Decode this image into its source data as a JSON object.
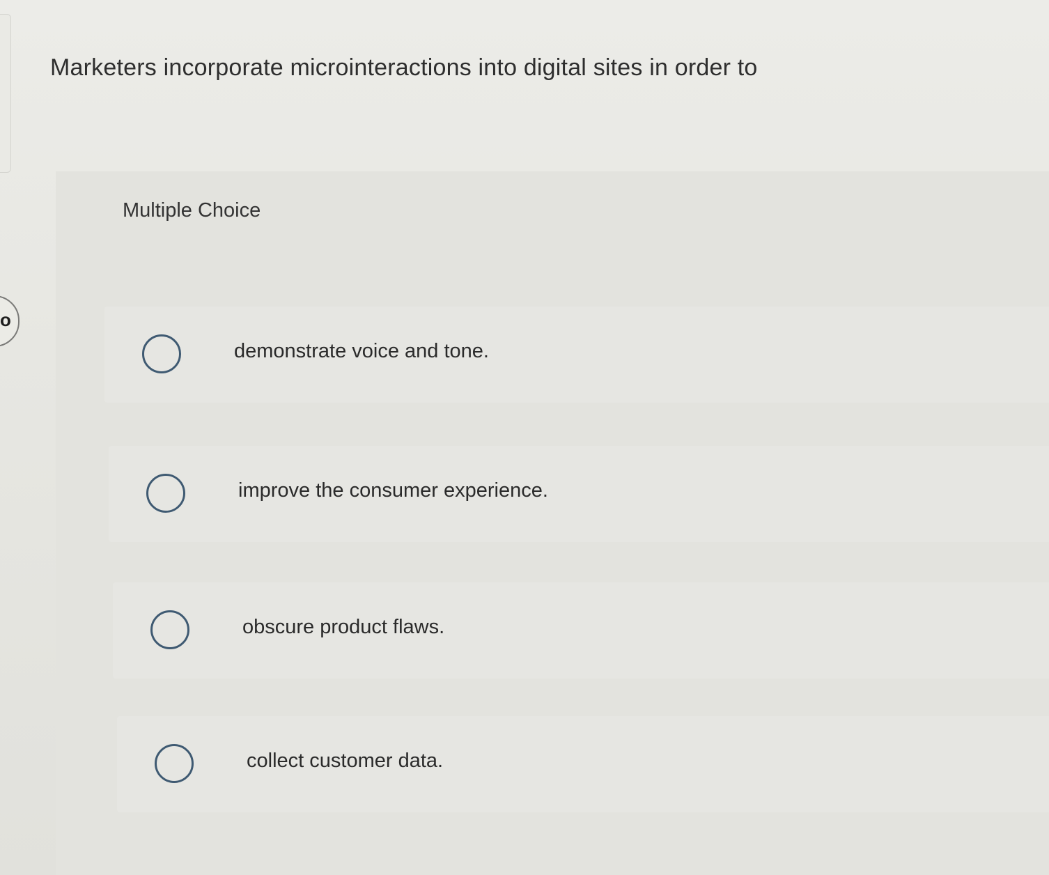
{
  "question": {
    "text": "Marketers incorporate microinteractions into digital sites in order to"
  },
  "nav": {
    "tab_glyph": "o"
  },
  "answer_area": {
    "type_label": "Multiple Choice",
    "options": [
      {
        "label": "demonstrate voice and tone.",
        "selected": false
      },
      {
        "label": "improve the consumer experience.",
        "selected": false
      },
      {
        "label": "obscure product flaws.",
        "selected": false
      },
      {
        "label": "collect customer data.",
        "selected": false
      }
    ]
  },
  "colors": {
    "radio_border": "#3f5a72",
    "text": "#2a2a2a",
    "background": "#e6e6e1"
  }
}
